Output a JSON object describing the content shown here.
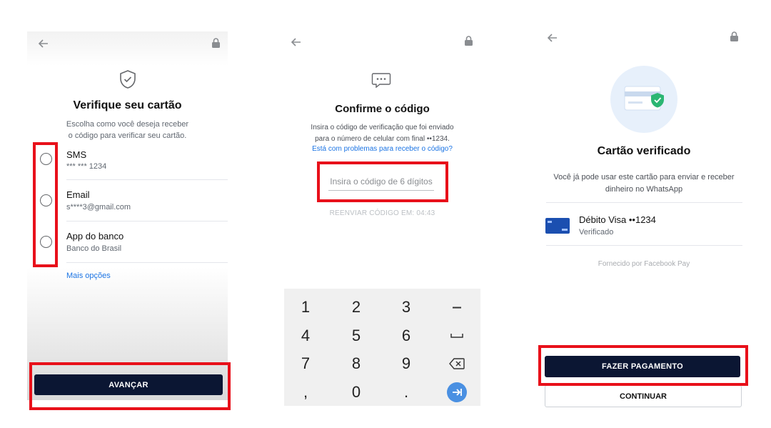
{
  "screen1": {
    "title": "Verifique seu cartão",
    "subtitle_line1": "Escolha como você deseja receber",
    "subtitle_line2": "o código para verificar seu cartão.",
    "options": [
      {
        "label": "SMS",
        "detail": "*** *** 1234"
      },
      {
        "label": "Email",
        "detail": "s****3@gmail.com"
      },
      {
        "label": "App do banco",
        "detail": "Banco do Brasil"
      }
    ],
    "more_options": "Mais opções",
    "continue_button": "AVANÇAR",
    "icons": {
      "back": "arrow-left-icon",
      "lock": "lock-icon",
      "shield": "shield-check-icon"
    }
  },
  "screen2": {
    "title": "Confirme o código",
    "subtitle_line1": "Insira o código de verificação que foi enviado",
    "subtitle_line2": "para o número de celular com final ••1234.",
    "help_link": "Está com problemas para receber o código?",
    "code_placeholder": "Insira o código de 6 dígitos",
    "resend": "REENVIAR CÓDIGO EM: 04:43",
    "keys": [
      "1",
      "2",
      "3",
      "–",
      "4",
      "5",
      "6",
      "␣",
      "7",
      "8",
      "9",
      "⌫",
      ",",
      "0",
      ".",
      "→"
    ],
    "icons": {
      "back": "arrow-left-icon",
      "lock": "lock-icon",
      "chat": "chat-bubble-icon"
    }
  },
  "screen3": {
    "title": "Cartão verificado",
    "subtitle_line1": "Você já pode usar este cartão para enviar e receber",
    "subtitle_line2": "dinheiro no WhatsApp",
    "card_name": "Débito Visa ••1234",
    "card_status": "Verificado",
    "provided_by": "Fornecido por Facebook Pay",
    "pay_button": "FAZER PAGAMENTO",
    "continue_button": "CONTINUAR",
    "icons": {
      "back": "arrow-left-icon",
      "lock": "lock-icon",
      "card": "card-verified-icon"
    }
  },
  "colors": {
    "primary_button": "#0b1633",
    "link": "#1b74e4",
    "highlight": "#e8101a",
    "shield_green": "#2bb673"
  }
}
